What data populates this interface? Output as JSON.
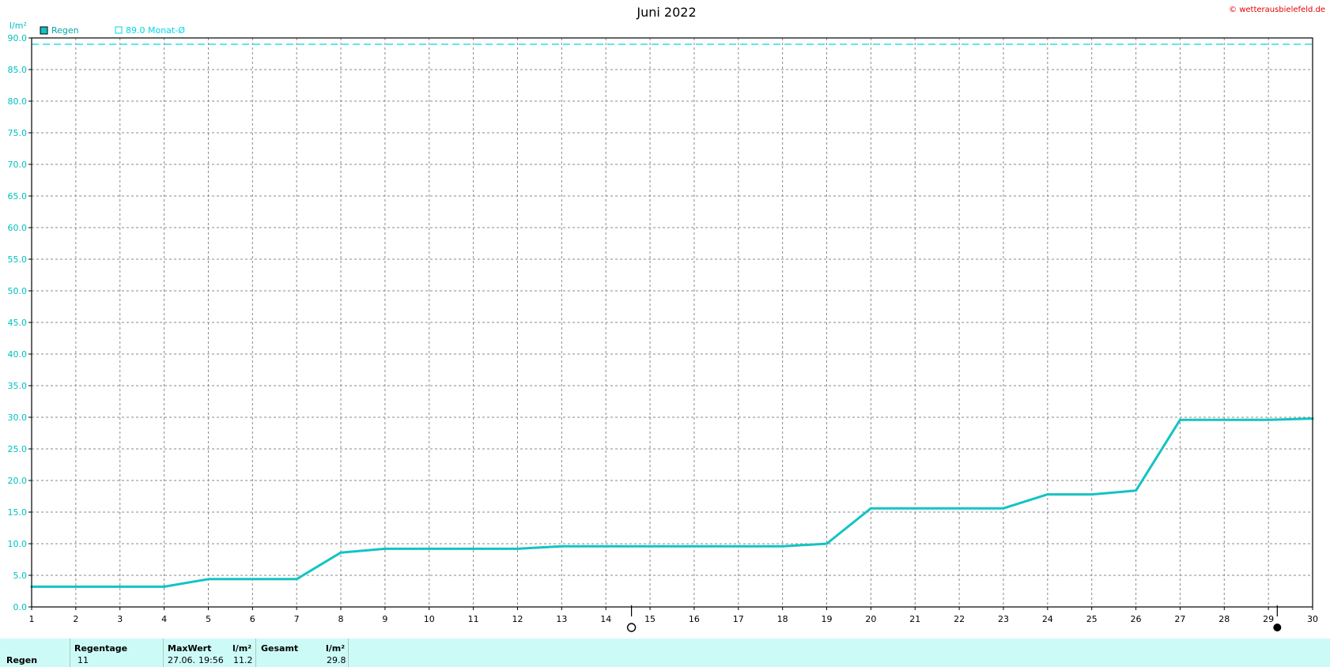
{
  "header": {
    "copyright": "© wetterausbielefeld.de"
  },
  "legend": {
    "series_label": "Regen",
    "average_label": "89.0 Monat-Ø"
  },
  "colors": {
    "series": "#14c3c3",
    "average": "#00d8e8",
    "axis_text": "#00c0c0",
    "grid": "#8a8a8a",
    "copyright": "#e60000",
    "stats_bg": "#ccfbf7"
  },
  "chart_data": {
    "type": "line",
    "title": "Juni 2022",
    "ylabel": "l/m²",
    "xlabel": "",
    "xlim": [
      1,
      30
    ],
    "ylim": [
      0,
      90
    ],
    "ytick_step": 5,
    "x_ticks": [
      1,
      2,
      3,
      4,
      5,
      6,
      7,
      8,
      9,
      10,
      11,
      12,
      13,
      14,
      15,
      16,
      17,
      18,
      19,
      20,
      21,
      22,
      23,
      24,
      25,
      26,
      27,
      28,
      29,
      30
    ],
    "grid": true,
    "legend_position": "top-left",
    "average_line": {
      "value": 89.0
    },
    "moon_phases": [
      {
        "x": 14.58,
        "phase": "full-moon"
      },
      {
        "x": 29.2,
        "phase": "new-moon"
      }
    ],
    "series": [
      {
        "name": "Regen",
        "x": [
          1,
          4,
          5,
          7,
          8,
          9,
          12,
          13,
          18,
          19,
          20,
          23,
          24,
          25,
          26,
          27,
          29,
          30
        ],
        "values": [
          3.2,
          3.2,
          4.4,
          4.4,
          8.6,
          9.2,
          9.2,
          9.6,
          9.6,
          10.0,
          15.6,
          15.6,
          17.8,
          17.8,
          18.4,
          29.6,
          29.6,
          29.8
        ]
      }
    ]
  },
  "stats": {
    "row_label": "Regen",
    "regentage_header": "Regentage",
    "regentage_value": "11",
    "maxwert_header": "MaxWert",
    "maxwert_unit": "l/m²",
    "maxwert_date": "27.06.",
    "maxwert_time": "19:56",
    "maxwert_value": "11.2",
    "gesamt_header": "Gesamt",
    "gesamt_unit": "l/m²",
    "gesamt_value": "29.8"
  }
}
